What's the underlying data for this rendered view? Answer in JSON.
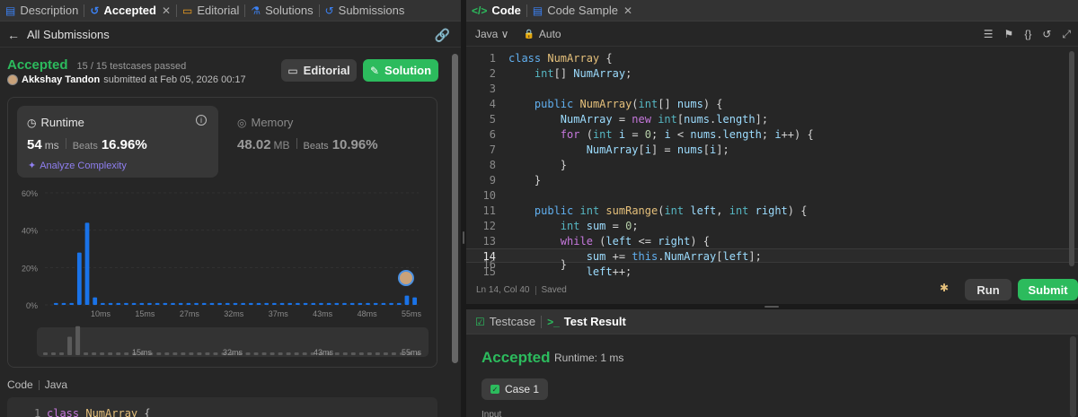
{
  "left": {
    "tabs": [
      {
        "label": "Description",
        "icon": "document-icon",
        "color": "#3b82f6"
      },
      {
        "label": "Accepted",
        "icon": "history-icon",
        "color": "#3b82f6"
      },
      {
        "label": "Editorial",
        "icon": "book-icon",
        "color": "#f0a020"
      },
      {
        "label": "Solutions",
        "icon": "flask-icon",
        "color": "#3b82f6"
      },
      {
        "label": "Submissions",
        "icon": "history-icon",
        "color": "#3b82f6"
      }
    ],
    "close_glyph": "✕",
    "subheader": {
      "back_glyph": "←",
      "title": "All Submissions"
    },
    "submission": {
      "status": "Accepted",
      "testcases": "15 / 15 testcases passed",
      "author": "Akkshay Tandon",
      "submitted": "submitted at Feb 05, 2026 00:17"
    },
    "buttons": {
      "editorial": "Editorial",
      "solution": "Solution"
    },
    "runtime": {
      "label": "Runtime",
      "value": "54",
      "unit": "ms",
      "beats_label": "Beats",
      "beats": "16.96%",
      "analyze": "Analyze Complexity"
    },
    "memory": {
      "label": "Memory",
      "value": "48.02",
      "unit": "MB",
      "beats_label": "Beats",
      "beats": "10.96%"
    },
    "code_header": {
      "label": "Code",
      "lang": "Java"
    },
    "code_snippet": {
      "line": "1",
      "text": "class NumArray {"
    }
  },
  "chart_data": {
    "type": "bar",
    "title": "",
    "ylabel": "",
    "y_ticks": [
      "60%",
      "40%",
      "20%",
      "0%"
    ],
    "ylim": [
      0,
      60
    ],
    "x_ticks": [
      "10ms",
      "15ms",
      "27ms",
      "32ms",
      "37ms",
      "43ms",
      "48ms",
      "55ms"
    ],
    "values": [
      1,
      1,
      1,
      28,
      44,
      4,
      1,
      1,
      1,
      1,
      1,
      1,
      1,
      1,
      1,
      1,
      1,
      1,
      1,
      1,
      1,
      1,
      1,
      1,
      1,
      1,
      1,
      1,
      1,
      1,
      1,
      1,
      1,
      1,
      1,
      1,
      1,
      1,
      1,
      1,
      1,
      1,
      1,
      1,
      1,
      5,
      4
    ],
    "highlight_index": 45,
    "accent": "#1a73e8",
    "mini_ticks": [
      "15ms",
      "32ms",
      "43ms",
      "55ms"
    ]
  },
  "editor": {
    "tabs": [
      {
        "label": "Code",
        "icon": "code-icon",
        "color": "#2cbb5d"
      },
      {
        "label": "Code Sample",
        "icon": "document-icon",
        "color": "#3b82f6"
      }
    ],
    "close_glyph": "✕",
    "language": "Java ∨",
    "mode": "Auto",
    "lines": [
      "class NumArray {",
      "    int[] NumArray;",
      "",
      "    public NumArray(int[] nums) {",
      "        NumArray = new int[nums.length];",
      "        for (int i = 0; i < nums.length; i++) {",
      "            NumArray[i] = nums[i];",
      "        }",
      "    }",
      "",
      "    public int sumRange(int left, int right) {",
      "        int sum = 0;",
      "        while (left <= right) {",
      "            sum += this.NumArray[left];",
      "            left++;",
      "        }"
    ],
    "current_line": 14,
    "status": {
      "position": "Ln 14, Col 40",
      "saved": "Saved"
    },
    "buttons": {
      "run": "Run",
      "submit": "Submit"
    }
  },
  "result": {
    "tabs": [
      {
        "label": "Testcase",
        "icon": "checkbox-icon",
        "color": "#2cbb5d"
      },
      {
        "label": "Test Result",
        "icon": "terminal-icon",
        "color": "#2cbb5d"
      }
    ],
    "status": "Accepted",
    "runtime": "Runtime: 1 ms",
    "case": "Case 1",
    "input_label": "Input"
  }
}
